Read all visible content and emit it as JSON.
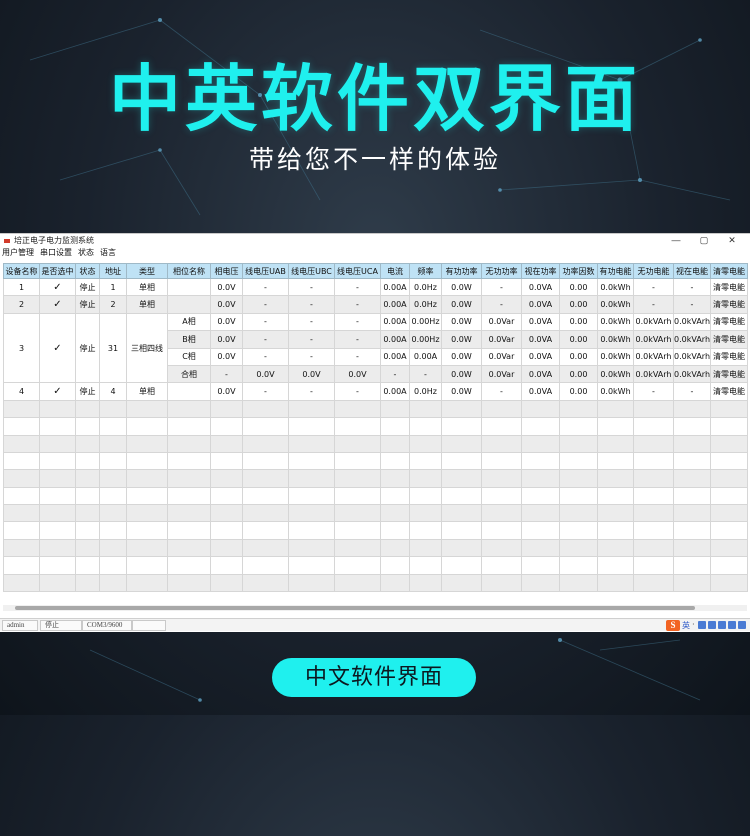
{
  "hero": {
    "title": "中英软件双界面",
    "subtitle": "带给您不一样的体验"
  },
  "window": {
    "title": "培正电子电力监测系统",
    "controls": [
      "—",
      "▢",
      "✕"
    ],
    "menu": [
      "用户管理",
      "串口设置",
      "状态",
      "语言"
    ]
  },
  "table": {
    "columns": [
      "设备名称",
      "是否选中",
      "状态",
      "地址",
      "类型",
      "相位名称",
      "相电压",
      "线电压UAB",
      "线电压UBC",
      "线电压UCA",
      "电流",
      "频率",
      "有功功率",
      "无功功率",
      "视在功率",
      "功率因数",
      "有功电能",
      "无功电能",
      "视在电能",
      "清零电能"
    ],
    "rows": [
      [
        "1",
        "✓",
        "停止",
        "1",
        "单相",
        "",
        "0.0V",
        "-",
        "-",
        "-",
        "0.00A",
        "0.0Hz",
        "0.0W",
        "-",
        "0.0VA",
        "0.00",
        "0.0kWh",
        "-",
        "-",
        "清零电能"
      ],
      [
        "2",
        "✓",
        "停止",
        "2",
        "单相",
        "",
        "0.0V",
        "-",
        "-",
        "-",
        "0.00A",
        "0.0Hz",
        "0.0W",
        "-",
        "0.0VA",
        "0.00",
        "0.0kWh",
        "-",
        "-",
        "清零电能"
      ],
      [
        "3",
        "✓",
        "停止",
        "31",
        "三相四线",
        "A相",
        "0.0V",
        "-",
        "-",
        "-",
        "0.00A",
        "0.00Hz",
        "0.0W",
        "0.0Var",
        "0.0VA",
        "0.00",
        "0.0kWh",
        "0.0kVArh",
        "0.0kVArh",
        "清零电能"
      ],
      [
        "",
        "",
        "",
        "",
        "",
        "B相",
        "0.0V",
        "-",
        "-",
        "-",
        "0.00A",
        "0.00Hz",
        "0.0W",
        "0.0Var",
        "0.0VA",
        "0.00",
        "0.0kWh",
        "0.0kVArh",
        "0.0kVArh",
        "清零电能"
      ],
      [
        "",
        "",
        "",
        "",
        "",
        "C相",
        "0.0V",
        "-",
        "-",
        "-",
        "0.00A",
        "0.00A",
        "0.0W",
        "0.0Var",
        "0.0VA",
        "0.00",
        "0.0kWh",
        "0.0kVArh",
        "0.0kVArh",
        "清零电能"
      ],
      [
        "",
        "",
        "",
        "",
        "",
        "合相",
        "-",
        "0.0V",
        "0.0V",
        "0.0V",
        "-",
        "-",
        "0.0W",
        "0.0Var",
        "0.0VA",
        "0.00",
        "0.0kWh",
        "0.0kVArh",
        "0.0kVArh",
        "清零电能"
      ],
      [
        "4",
        "✓",
        "停止",
        "4",
        "单相",
        "",
        "0.0V",
        "-",
        "-",
        "-",
        "0.00A",
        "0.0Hz",
        "0.0W",
        "-",
        "0.0VA",
        "0.00",
        "0.0kWh",
        "-",
        "-",
        "清零电能"
      ]
    ]
  },
  "statusbar": {
    "user": "admin",
    "state": "停止",
    "port": "COM3/9600"
  },
  "tray": {
    "ime_logo": "S",
    "ime_mode": "英"
  },
  "caption": "中文软件界面",
  "colors": {
    "accent": "#1ff0ee",
    "header": "#bfe2f5",
    "background": "#1a222d"
  }
}
